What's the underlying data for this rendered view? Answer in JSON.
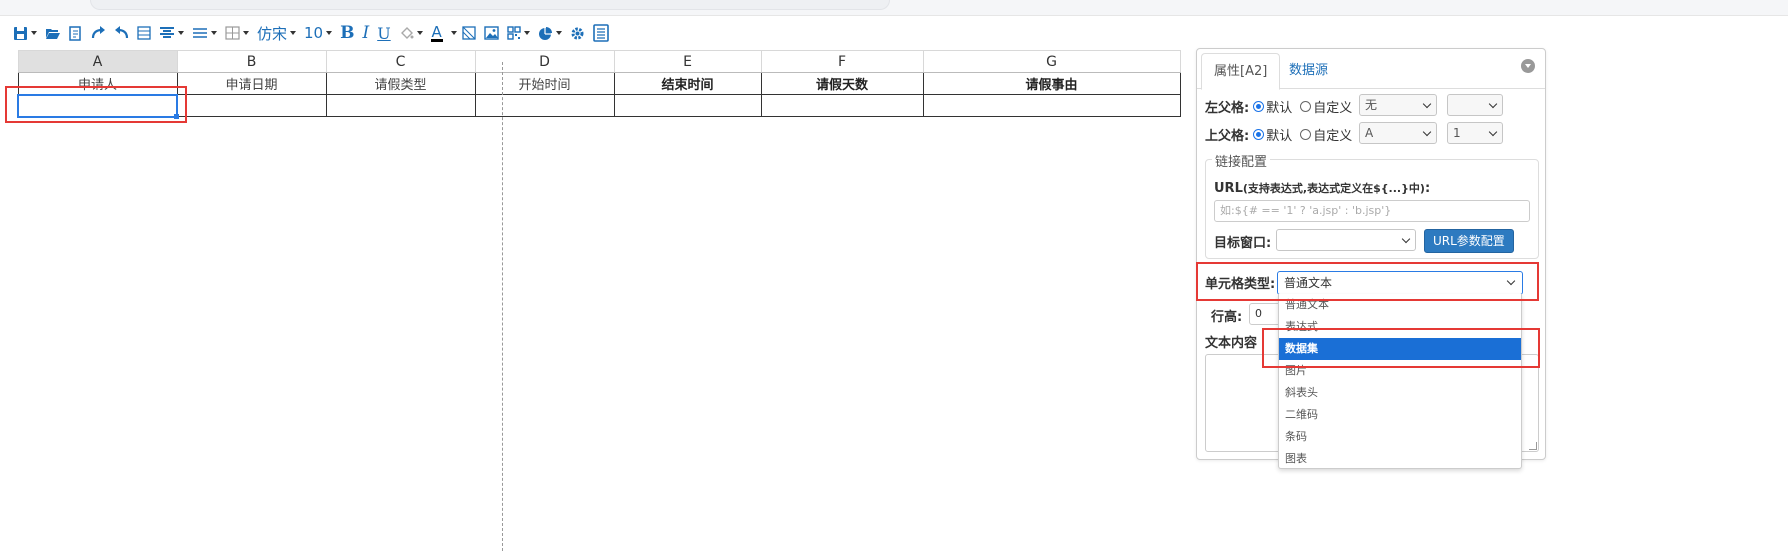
{
  "toolbar": {
    "font_name": "仿宋",
    "font_size": "10",
    "bold": "B",
    "italic": "I",
    "underline": "U",
    "font_color": "A"
  },
  "sheet": {
    "columns": [
      "A",
      "B",
      "C",
      "D",
      "E",
      "F",
      "G"
    ],
    "active_column": "A",
    "header_row": [
      "申请人",
      "申请日期",
      "请假类型",
      "开始时间",
      "结束时间",
      "请假天数",
      "请假事由"
    ],
    "selected_cell": "A2"
  },
  "panel": {
    "tab_properties": "属性[A2]",
    "tab_datasource": "数据源",
    "left_parent_label": "左父格:",
    "left_parent_default": "默认",
    "left_parent_custom": "自定义",
    "left_parent_value": "无",
    "left_parent_value2": "",
    "top_parent_label": "上父格:",
    "top_parent_default": "默认",
    "top_parent_custom": "自定义",
    "top_parent_value": "A",
    "top_parent_value2": "1",
    "link_legend": "链接配置",
    "url_label_bold": "URL",
    "url_label_hint": "(支持表达式,表达式定义在${...}中)",
    "url_label_colon": ":",
    "url_placeholder": "如:${# == '1' ? 'a.jsp' : 'b.jsp'}",
    "target_label": "目标窗口:",
    "target_value": "",
    "url_param_button": "URL参数配置",
    "cell_type_label": "单元格类型:",
    "cell_type_value": "普通文本",
    "row_height_label": "行高:",
    "row_height_value": "0",
    "text_content_label": "文本内容"
  },
  "dropdown": {
    "options": [
      "普通文本",
      "表达式",
      "数据集",
      "图片",
      "斜表头",
      "二维码",
      "条码",
      "图表"
    ],
    "highlighted": "数据集"
  }
}
